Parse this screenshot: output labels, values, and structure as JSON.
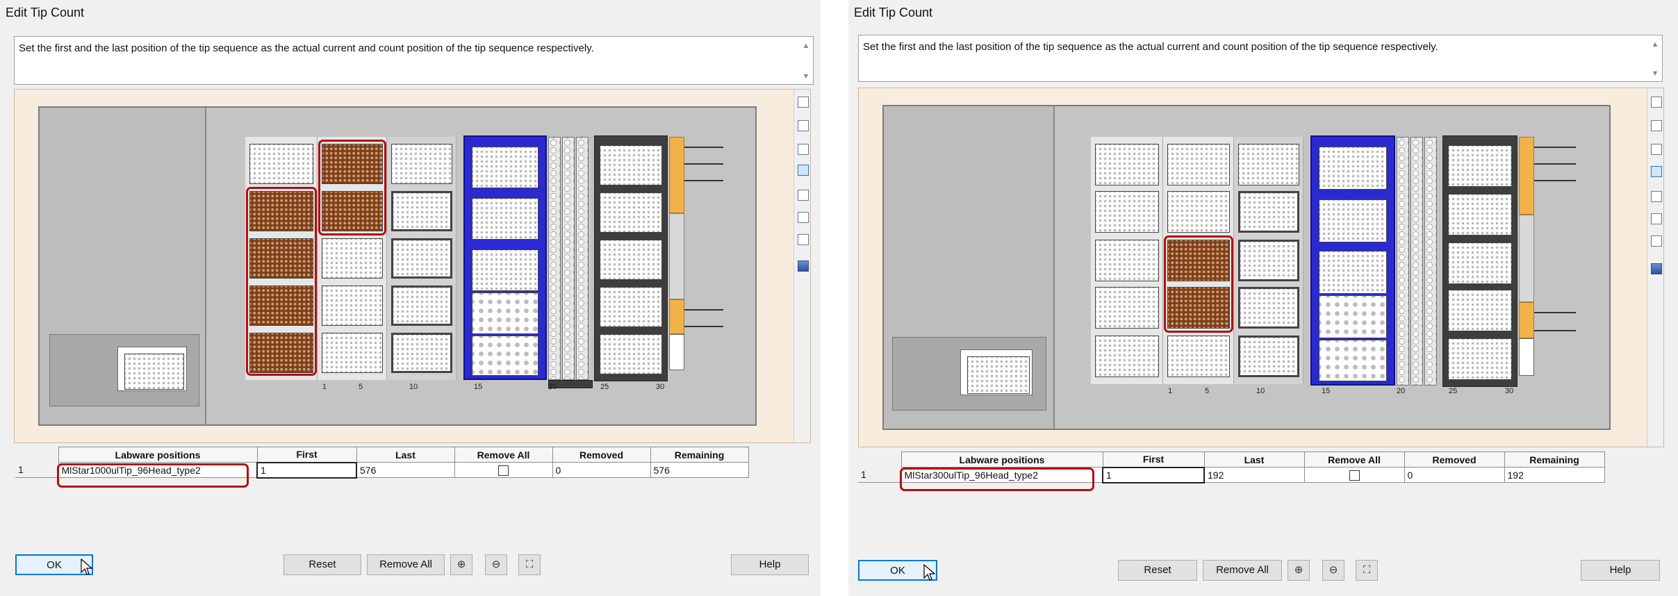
{
  "dialog": {
    "title": "Edit Tip Count",
    "message": "Set the first and the last position of the tip sequence as the actual  current and count position of the tip sequence respectively.",
    "columns": [
      "Labware positions",
      "First",
      "Last",
      "Remove All",
      "Removed",
      "Remaining"
    ],
    "ticks": [
      "1",
      "5",
      "10",
      "15",
      "20",
      "25",
      "30"
    ],
    "buttons": {
      "ok": "OK",
      "reset": "Reset",
      "remove_all": "Remove All",
      "help": "Help"
    },
    "icons": {
      "zoom_in": "zoom-in-icon",
      "zoom_out": "zoom-out-icon",
      "fit": "fit-to-window-icon"
    }
  },
  "left": {
    "row": {
      "index": "1",
      "labware": "MlStar1000ulTip_96Head_type2",
      "first": "1",
      "last": "576",
      "remove_all_checked": false,
      "removed": "0",
      "remaining": "576"
    }
  },
  "right": {
    "row": {
      "index": "1",
      "labware": "MlStar300ulTip_96Head_type2",
      "first": "1",
      "last": "192",
      "remove_all_checked": false,
      "removed": "0",
      "remaining": "192"
    }
  },
  "colors": {
    "tip_highlight": "#b01010",
    "tip_fill": "#7b3f1c",
    "carrier_blue": "#2a2ad0",
    "default_button": "#0078d7"
  }
}
